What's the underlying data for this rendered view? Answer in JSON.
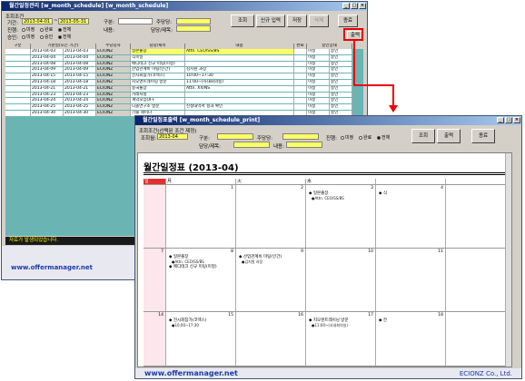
{
  "back_window": {
    "title": "월간일정관리 [w_month_schedule] [w_month_schedule]",
    "cond_label": "조회조건",
    "period_label": "기간:",
    "date_from": "2013-04-01",
    "date_to": "2013-05-31",
    "progress_label": "진행:",
    "approve_label": "승인:",
    "radio_before": "미정",
    "radio_done": "완료",
    "radio_all": "전체",
    "radio_approved": "승인",
    "type_label": "구분:",
    "owner_label": "주당당:",
    "person_label": "담당/제목:",
    "content_label": "내용:",
    "btn_search": "조회",
    "btn_new": "신규 입력",
    "btn_save": "저장",
    "btn_delete": "삭제",
    "btn_close": "종료",
    "btn_print": "출력",
    "grid_headers": [
      "구분",
      "기준일(또는 기간)",
      "주당당자",
      "담당/제목",
      "내용",
      "완료",
      "승인상태"
    ],
    "rows": [
      {
        "from": "2013-04-03",
        "to": "2013-04-03",
        "org": "ECIONZ",
        "title": "일본출장",
        "content": "Attn. CEO/SS/BS",
        "st1": "미정",
        "st2": "승인"
      },
      {
        "from": "2013-04-04",
        "to": "2013-04-04",
        "org": "ECIONZ",
        "title": "식목일",
        "content": "",
        "st1": "미정",
        "st2": "승인"
      },
      {
        "from": "2013-04-08",
        "to": "2013-04-08",
        "org": "ECIONZ",
        "title": "메디테크 신규 미팅(미정)",
        "content": "",
        "st1": "미정",
        "st2": "승인"
      },
      {
        "from": "2013-04-09",
        "to": "2013-04-09",
        "org": "ECIONZ",
        "title": "산업관계비 미팅(인간)",
        "content": "김지원 과장",
        "st1": "미정",
        "st2": "승인"
      },
      {
        "from": "2013-04-15",
        "to": "2013-04-15",
        "org": "ECIONZ",
        "title": "전시회참가(코엑스)",
        "content": "10:00~17:30",
        "st1": "미정",
        "st2": "승인"
      },
      {
        "from": "2013-04-18",
        "to": "2013-04-18",
        "org": "ECIONZ",
        "title": "지오엔트레이닝 방문",
        "content": "11:00~(사내회의실)",
        "st1": "미정",
        "st2": "승인"
      },
      {
        "from": "2013-04-21",
        "to": "2013-04-21",
        "org": "ECIONZ",
        "title": "중국출장",
        "content": "Attn. XX/NS",
        "st1": "미정",
        "st2": "승인"
      },
      {
        "from": "2013-04-23",
        "to": "2013-04-23",
        "org": "ECIONZ",
        "title": "거래처실",
        "content": "",
        "st1": "미정",
        "st2": "승인"
      },
      {
        "from": "2013-04-24",
        "to": "2013-04-24",
        "org": "ECIONZ",
        "title": "계약모임OFF",
        "content": "",
        "st1": "미정",
        "st2": "승인"
      },
      {
        "from": "2013-04-25",
        "to": "2013-04-25",
        "org": "ECIONZ",
        "title": "디올연구소 방문",
        "content": "신청내역서 결과 확인",
        "st1": "미정",
        "st2": "승인"
      },
      {
        "from": "2013-04-30",
        "to": "2013-04-30",
        "org": "ECIONZ",
        "title": "기술 세미나",
        "content": "",
        "st1": "미정",
        "st2": "승인"
      }
    ],
    "status_text": "자료가 발생되었습니다.",
    "footer_url": "www.offermanager.net"
  },
  "front_window": {
    "title": "월간일정표출력 [w_month_schedule_print]",
    "cond_label": "조회조건(선택된 조건 제정)",
    "month_label": "조회월:",
    "month_value": "2013-04",
    "type_label": "구분:",
    "owner_label": "주당당:",
    "person_label": "담당/제목:",
    "content_label": "내용:",
    "progress_label": "진행:",
    "radio_before": "미정",
    "radio_done": "완료",
    "radio_all": "전체",
    "btn_search": "조회",
    "btn_print": "출력",
    "btn_close": "종료",
    "cal_title": "월간일정표 (2013-04)",
    "days": [
      "일",
      "月",
      "火",
      "水"
    ],
    "week1": {
      "sun": "",
      "mon": "1",
      "tue": "2",
      "wed": "3",
      "thu": "4"
    },
    "week1_events": {
      "wed": "◆ 일본출장",
      "wed_sub": "●Attn. CEO/SS/BS",
      "thu": "◆ 식"
    },
    "week2": {
      "sun": "7",
      "mon": "8",
      "tue": "9",
      "wed": "10",
      "thu": "11"
    },
    "week2_events": {
      "mon1": "◆ 일본출장",
      "mon1_sub": "●Attn. CEO/SS/BS",
      "mon2": "◆ 메디테크 신규 미팅(미정)",
      "tue1": "◆ 산업관계비 미팅(인간)",
      "tue1_sub": "●김지원 과장"
    },
    "week3": {
      "sun": "14",
      "mon": "15",
      "tue": "16",
      "wed": "17",
      "thu": "18"
    },
    "week3_events": {
      "mon1": "◆ 전시회참가(코엑스)",
      "mon1_sub": "●10:00~17:30",
      "wed1": "◆ 지오엔트레이닝 방문",
      "wed1_sub": "●11:00~(사내회의실)",
      "thu1": "◆ 전"
    },
    "footer_url": "www.offermanager.net",
    "footer_company": "ECIONZ Co., Ltd."
  },
  "colors": {
    "highlight": "#e00000",
    "input_yellow": "#ffff66",
    "grid_teal": "#6ab4b4",
    "title_blue": "#0a246a"
  }
}
